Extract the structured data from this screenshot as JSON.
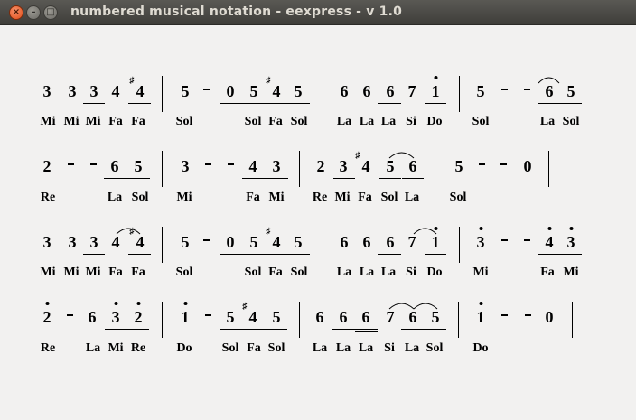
{
  "window": {
    "title": "numbered musical notation - eexpress - v 1.0"
  },
  "score": {
    "row1": {
      "n": [
        "3",
        "3",
        "3",
        "4",
        "4",
        "5",
        "-",
        "0",
        "5",
        "4",
        "5",
        "6",
        "6",
        "6",
        "7",
        "1",
        "5",
        "-",
        "-",
        "6",
        "5"
      ],
      "s": [
        "Mi",
        "Mi",
        "Mi",
        "Fa",
        "Fa",
        "Sol",
        "Sol",
        "Fa",
        "Sol",
        "La",
        "La",
        "La",
        "Si",
        "Do",
        "Sol",
        "La",
        "Sol"
      ]
    },
    "row2": {
      "n": [
        "2",
        "-",
        "-",
        "6",
        "5",
        "3",
        "-",
        "-",
        "4",
        "3",
        "2",
        "3",
        "4",
        "5",
        "6",
        "5",
        "-",
        "-",
        "0"
      ],
      "s": [
        "Re",
        "La",
        "Sol",
        "Mi",
        "Fa",
        "Mi",
        "Re",
        "Mi",
        "Fa",
        "Sol",
        "La",
        "Sol"
      ]
    },
    "row3": {
      "n": [
        "3",
        "3",
        "3",
        "4",
        "4",
        "5",
        "-",
        "0",
        "5",
        "4",
        "5",
        "6",
        "6",
        "6",
        "7",
        "1",
        "3",
        "-",
        "-",
        "4",
        "3"
      ],
      "s": [
        "Mi",
        "Mi",
        "Mi",
        "Fa",
        "Fa",
        "Sol",
        "Sol",
        "Fa",
        "Sol",
        "La",
        "La",
        "La",
        "Si",
        "Do",
        "Mi",
        "Fa",
        "Mi"
      ]
    },
    "row4": {
      "n": [
        "2",
        "-",
        "6",
        "3",
        "2",
        "1",
        "-",
        "5",
        "4",
        "5",
        "6",
        "6",
        "6",
        "7",
        "6",
        "5",
        "1",
        "-",
        "-",
        "0"
      ],
      "s": [
        "Re",
        "La",
        "Mi",
        "Re",
        "Do",
        "Sol",
        "Fa",
        "Sol",
        "La",
        "La",
        "La",
        "Si",
        "La",
        "Sol",
        "Do"
      ]
    }
  }
}
